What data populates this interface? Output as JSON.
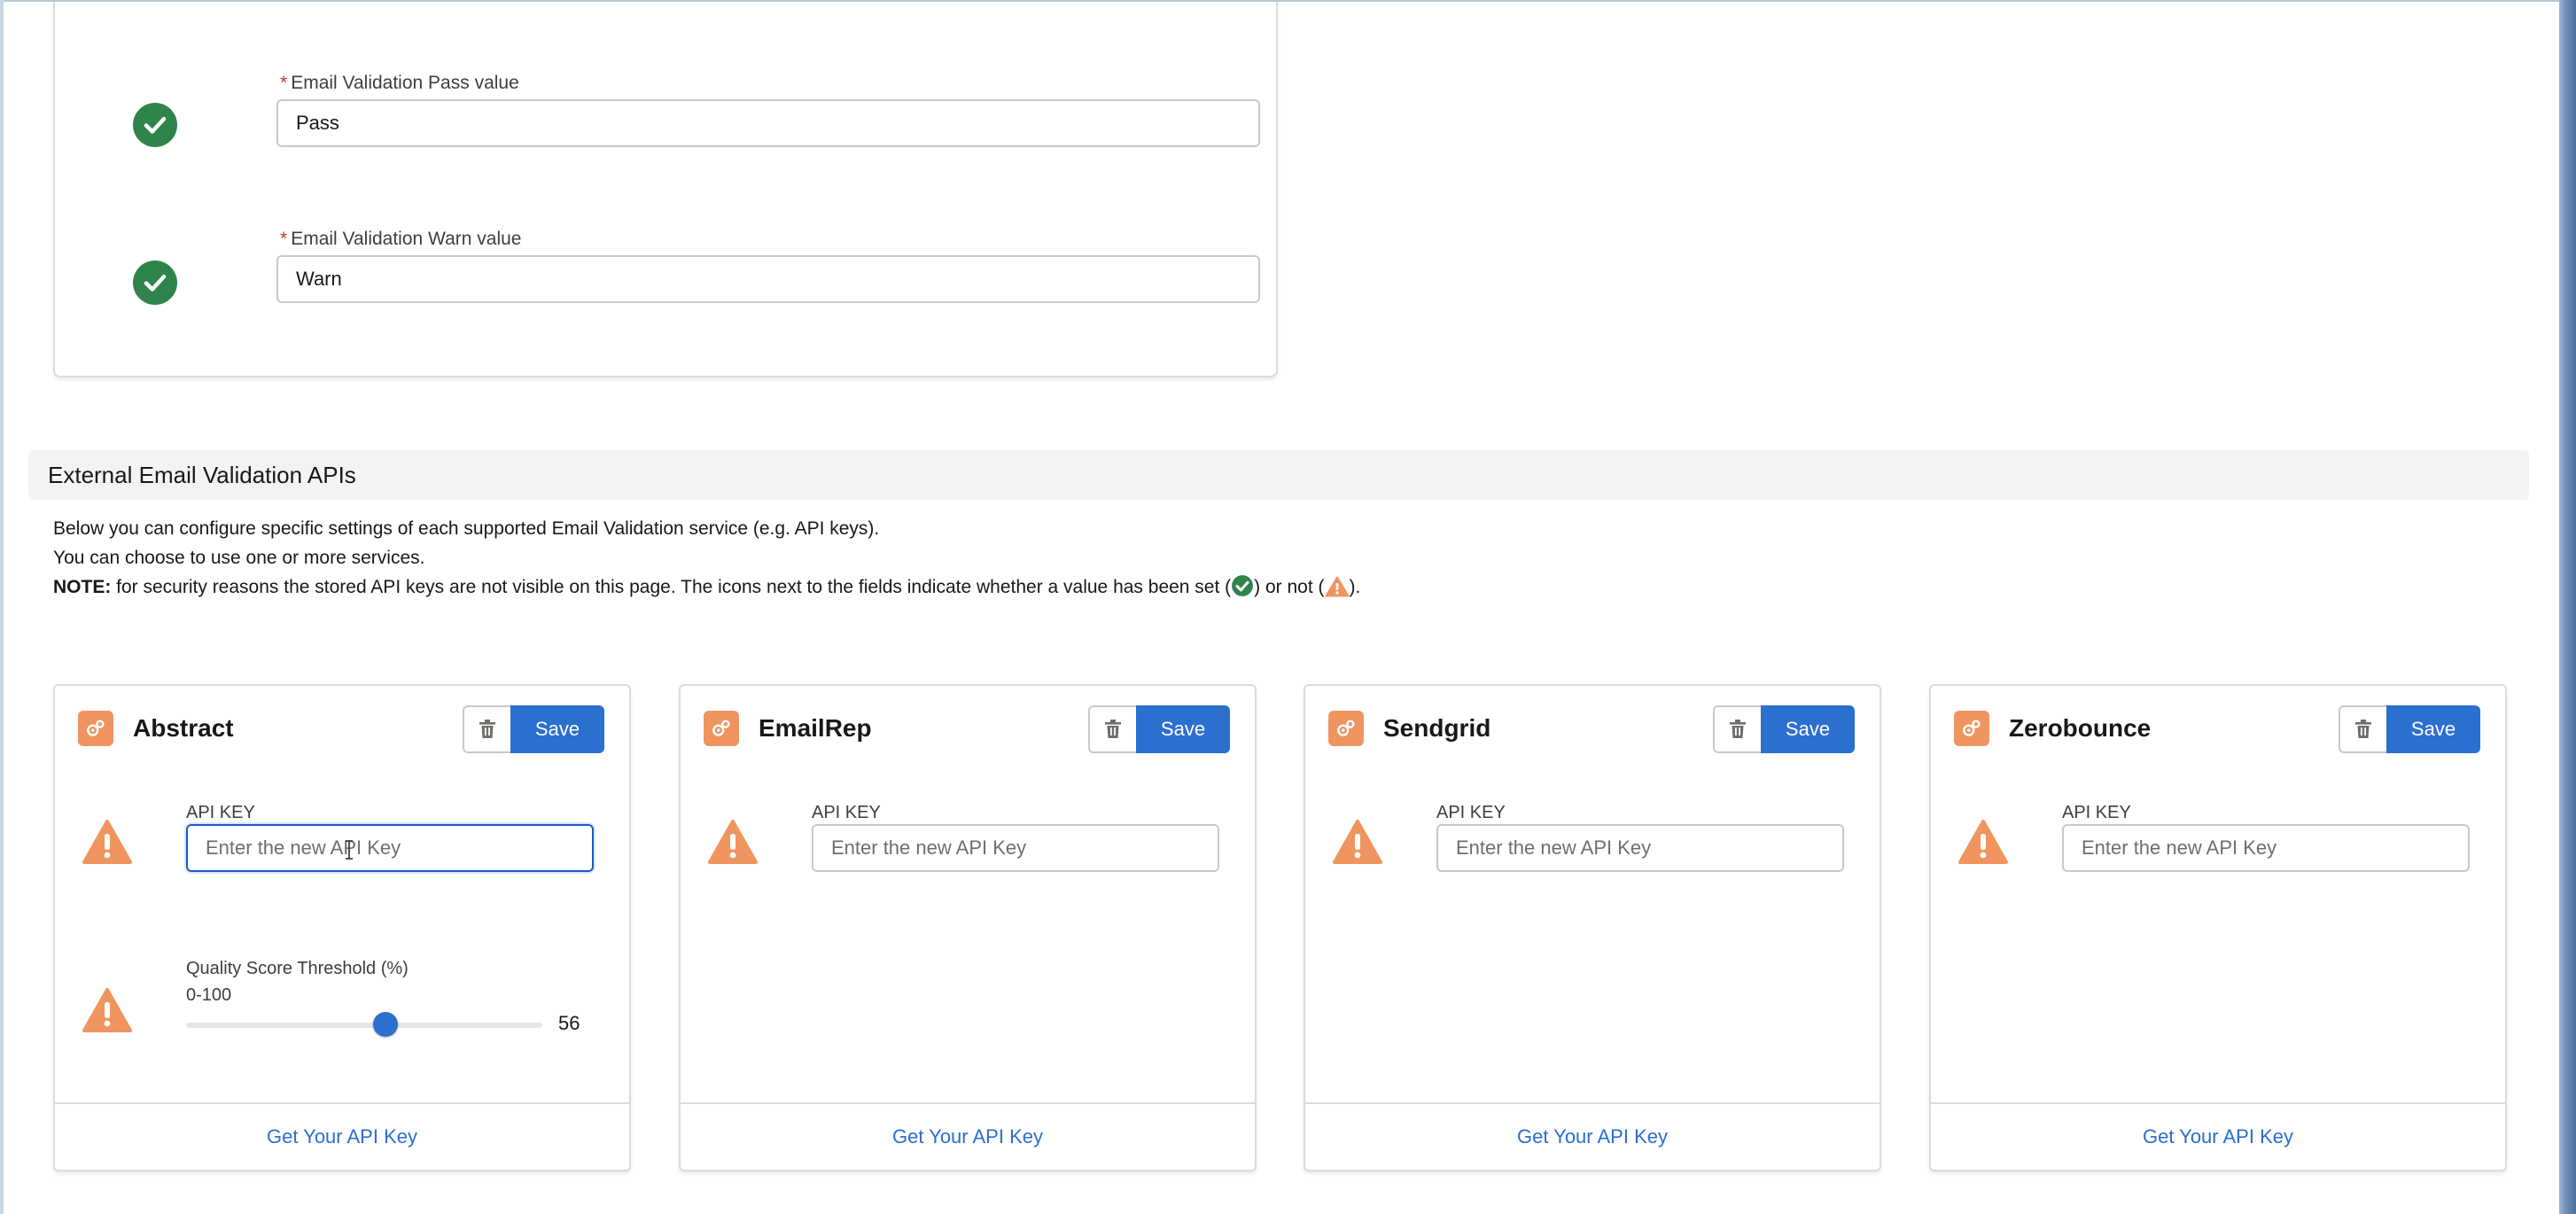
{
  "email_validation_values": [
    {
      "label": "Email Validation Pass value",
      "required_mark": "*",
      "value": "Pass",
      "status_icon": "check-circle-icon"
    },
    {
      "label": "Email Validation Warn value",
      "required_mark": "*",
      "value": "Warn",
      "status_icon": "check-circle-icon"
    }
  ],
  "section": {
    "title": "External Email Validation APIs",
    "line1": "Below you can configure specific settings of each supported Email Validation service (e.g. API keys).",
    "line2": "You can choose to use one or more services.",
    "note_label": "NOTE:",
    "note_text_a": " for security reasons the stored API keys are not visible on this page. The icons next to the fields indicate whether a value has been set (",
    "note_text_b": ") or not (",
    "note_text_c": ")."
  },
  "services": [
    {
      "name": "Abstract",
      "save_label": "Save",
      "api_key_label": "API KEY",
      "api_key_placeholder": "Enter the new API Key",
      "threshold_label": "Quality Score Threshold (%)",
      "threshold_range": "0-100",
      "threshold_value": "56",
      "footer_link": "Get Your API Key"
    },
    {
      "name": "EmailRep",
      "save_label": "Save",
      "api_key_label": "API KEY",
      "api_key_placeholder": "Enter the new API Key",
      "footer_link": "Get Your API Key"
    },
    {
      "name": "Sendgrid",
      "save_label": "Save",
      "api_key_label": "API KEY",
      "api_key_placeholder": "Enter the new API Key",
      "footer_link": "Get Your API Key"
    },
    {
      "name": "Zerobounce",
      "save_label": "Save",
      "api_key_label": "API KEY",
      "api_key_placeholder": "Enter the new API Key",
      "footer_link": "Get Your API Key"
    }
  ],
  "colors": {
    "success": "#2e844a",
    "warning": "#f0955f",
    "brand": "#2b6fcf",
    "link": "#2b6fcf"
  },
  "slider_fraction": 0.56
}
